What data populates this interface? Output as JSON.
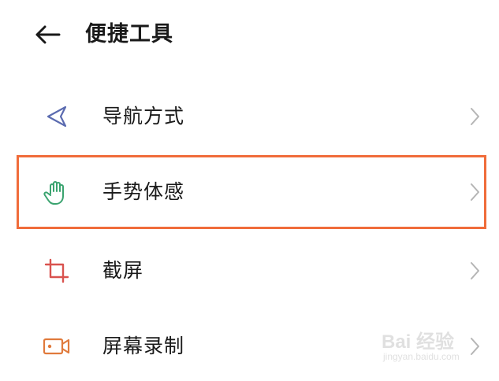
{
  "header": {
    "back_icon": "back-arrow-icon",
    "title": "便捷工具"
  },
  "list": {
    "items": [
      {
        "label": "导航方式",
        "icon": "navigation-arrow-icon",
        "icon_color": "#5b6bb0"
      },
      {
        "label": "手势体感",
        "icon": "hand-gesture-icon",
        "icon_color": "#3aa36f",
        "highlighted": true
      },
      {
        "label": "截屏",
        "icon": "crop-screenshot-icon",
        "icon_color": "#d9534f"
      },
      {
        "label": "屏幕录制",
        "icon": "video-record-icon",
        "icon_color": "#e07a3c"
      }
    ],
    "chevron_icon": "chevron-right-icon"
  },
  "highlight_color": "#f06c3a",
  "watermark": {
    "main": "Bai 经验",
    "sub": "jingyan.baidu.com"
  }
}
